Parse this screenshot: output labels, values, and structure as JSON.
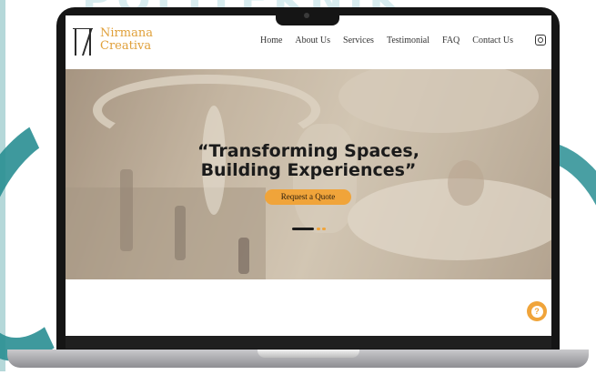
{
  "background": {
    "watermark_text": "POLITEKNIK",
    "accent_color": "#2a8f93"
  },
  "site": {
    "brand": {
      "line1": "Nirmana",
      "line2": "Creativa",
      "color": "#e0a03a"
    },
    "nav": [
      "Home",
      "About Us",
      "Services",
      "Testimonial",
      "FAQ",
      "Contact Us"
    ],
    "social_icon": "instagram-icon"
  },
  "hero": {
    "title_line1": "“Transforming Spaces,",
    "title_line2": "Building Experiences”",
    "cta_label": "Request a Quote",
    "cta_color": "#f0a43a",
    "slides_total": 3,
    "slide_active": 1
  },
  "help": {
    "label": "?",
    "icon": "help-icon"
  }
}
